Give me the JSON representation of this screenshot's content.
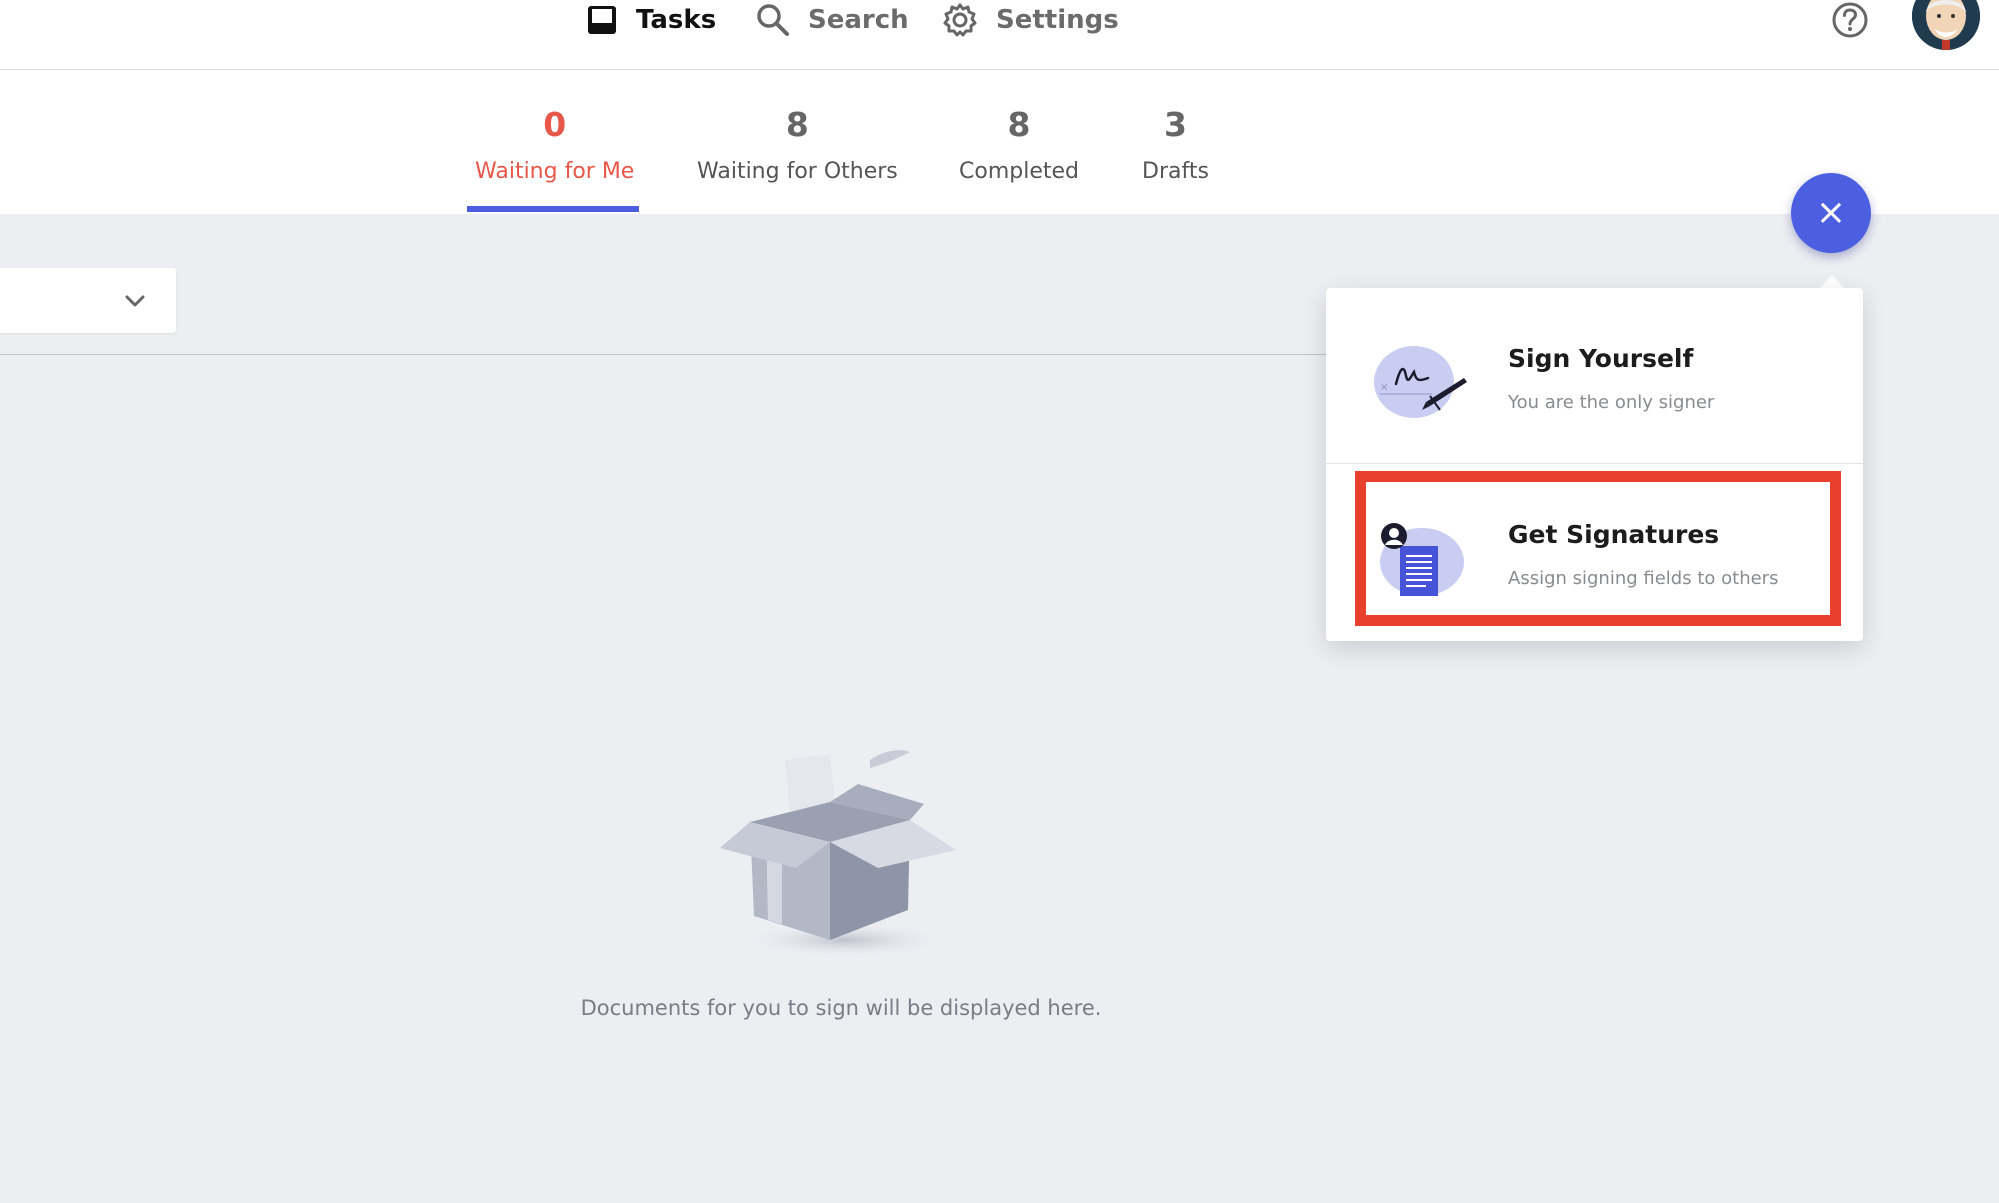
{
  "nav": {
    "tasks_label": "Tasks",
    "search_label": "Search",
    "settings_label": "Settings"
  },
  "tabs": [
    {
      "count": "0",
      "label": "Waiting for Me",
      "active": true
    },
    {
      "count": "8",
      "label": "Waiting for Others"
    },
    {
      "count": "8",
      "label": "Completed"
    },
    {
      "count": "3",
      "label": "Drafts"
    }
  ],
  "empty_state": {
    "message": "Documents for you to sign will be displayed here."
  },
  "fab": {
    "close_symbol": "×"
  },
  "menu": {
    "sign_yourself": {
      "title": "Sign Yourself",
      "subtitle": "You are the only signer"
    },
    "get_signatures": {
      "title": "Get Signatures",
      "subtitle": "Assign signing fields to others"
    }
  },
  "colors": {
    "accent": "#4c5fe0",
    "active_tab": "#e8584a",
    "highlight": "#e7402c"
  },
  "icons": [
    "inbox-icon",
    "search-icon",
    "gear-icon",
    "help-icon",
    "chevron-down-icon",
    "close-icon",
    "signature-icon",
    "document-icon"
  ]
}
